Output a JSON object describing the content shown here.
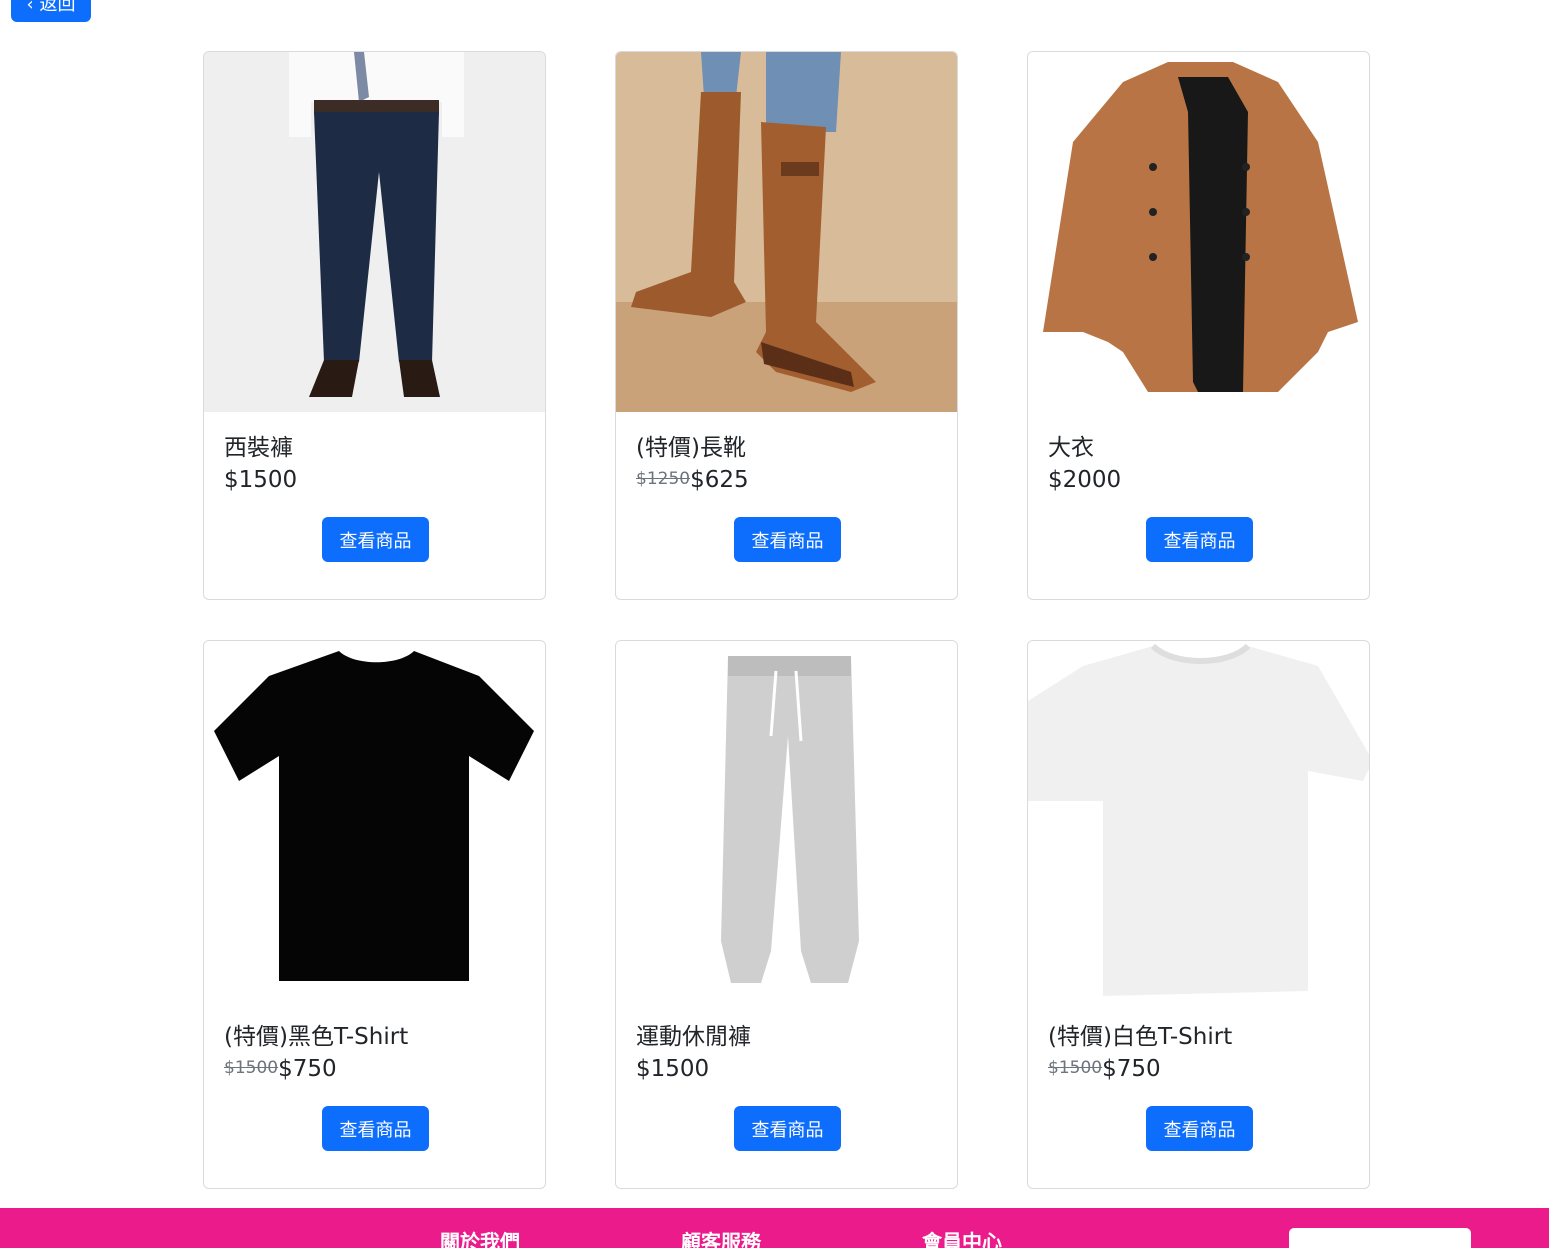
{
  "back_label": "‹ 返回",
  "products": [
    {
      "name": "西裝褲",
      "price": "$1500"
    },
    {
      "name": "(特價)長靴",
      "orig_price": "$1250",
      "price": "$625"
    },
    {
      "name": "大衣",
      "price": "$2000"
    },
    {
      "name": "(特價)黑色T-Shirt",
      "orig_price": "$1500",
      "price": "$750"
    },
    {
      "name": "運動休閒褲",
      "price": "$1500"
    },
    {
      "name": "(特價)白色T-Shirt",
      "orig_price": "$1500",
      "price": "$750"
    }
  ],
  "view_label": "查看商品",
  "footer": {
    "about": "關於我們",
    "service": "顧客服務",
    "member": "會員中心"
  },
  "colors": {
    "accent": "#0d6efd",
    "footer": "#ec1b8c"
  }
}
